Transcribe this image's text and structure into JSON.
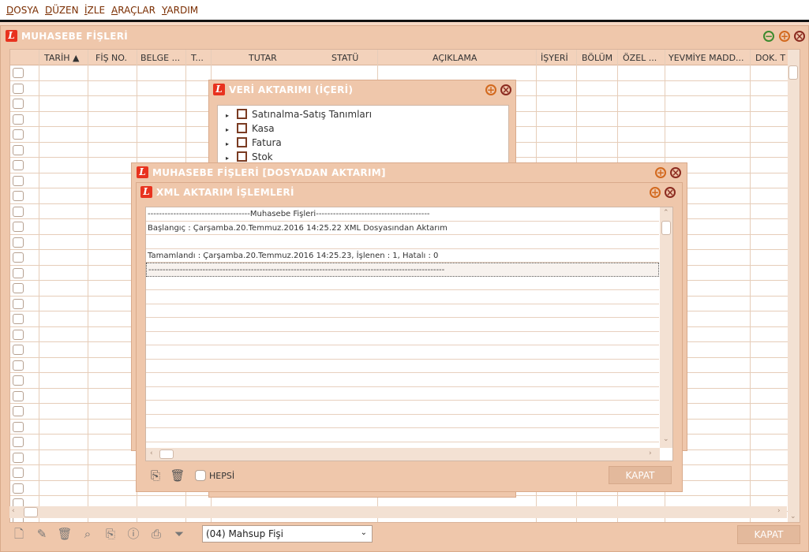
{
  "menu": [
    "DOSYA",
    "DÜZEN",
    "İZLE",
    "ARAÇLAR",
    "YARDIM"
  ],
  "main_window": {
    "title": "MUHASEBE FİŞLERİ",
    "columns": [
      "TARİH ▲",
      "FİŞ NO.",
      "BELGE ...",
      "T...",
      "TUTAR",
      "STATÜ",
      "AÇIKLAMA",
      "İŞYERİ",
      "BÖLÜM",
      "ÖZEL ...",
      "YEVMİYE MADD...",
      "DOK. T"
    ],
    "fis_type": "(04) Mahsup Fişi",
    "close_button": "KAPAT"
  },
  "veri_window": {
    "title": "VERİ AKTARIMI (İÇERİ)",
    "tree": [
      "Satınalma-Satış Tanımları",
      "Kasa",
      "Fatura",
      "Stok"
    ]
  },
  "dosyadan_window": {
    "title": "MUHASEBE FİŞLERİ [DOSYADAN AKTARIM]"
  },
  "xml_window": {
    "title": "XML AKTARIM İŞLEMLERİ",
    "log": [
      "------------------------------------Muhasebe Fişleri----------------------------------------",
      "Başlangıç : Çarşamba.20.Temmuz.2016   14:25.22   XML Dosyasından Aktarım",
      "",
      "Tamamlandı : Çarşamba.20.Temmuz.2016   14:25.23,  İşlenen : 1, Hatalı : 0",
      "--------------------------------------------------------------------------------------------------------"
    ],
    "hepsi_label": "HEPSİ",
    "close_button": "KAPAT"
  },
  "colors": {
    "title_text": "#ffffff",
    "window_bg": "#efc7ab",
    "menu_text": "#7a2d00"
  }
}
